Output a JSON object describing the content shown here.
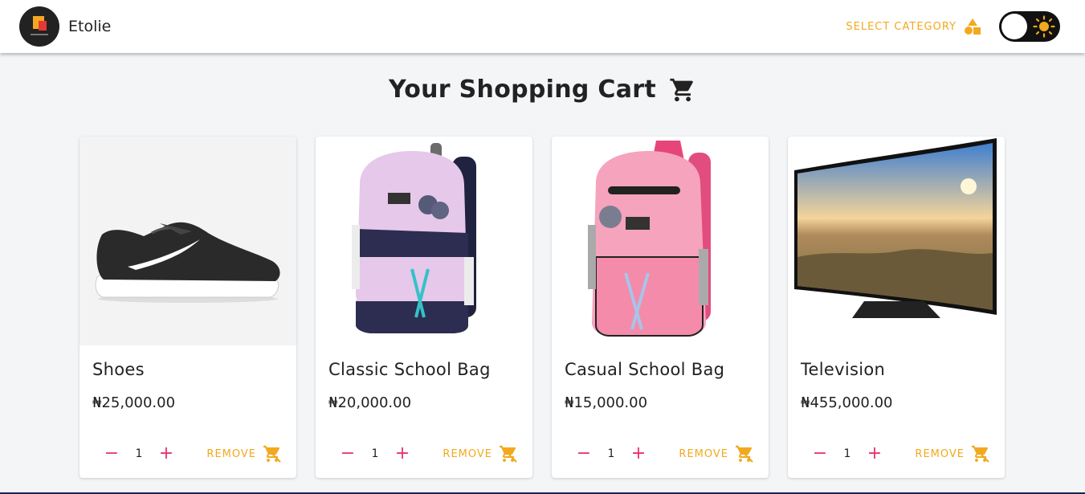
{
  "header": {
    "brand_name": "Etolie",
    "category_label": "SELECT CATEGORY"
  },
  "page": {
    "title": "Your Shopping Cart"
  },
  "cart": {
    "items": [
      {
        "name": "Shoes",
        "price": "₦25,000.00",
        "quantity": "1",
        "remove_label": "REMOVE",
        "image": "sneaker-image"
      },
      {
        "name": "Classic School Bag",
        "price": "₦20,000.00",
        "quantity": "1",
        "remove_label": "REMOVE",
        "image": "lavender-backpack-image"
      },
      {
        "name": "Casual School Bag",
        "price": "₦15,000.00",
        "quantity": "1",
        "remove_label": "REMOVE",
        "image": "pink-backpack-image"
      },
      {
        "name": "Television",
        "price": "₦455,000.00",
        "quantity": "1",
        "remove_label": "REMOVE",
        "image": "curved-tv-image"
      }
    ]
  },
  "colors": {
    "accent": "#f2a91e",
    "quantity_controls": "#e8336d",
    "background": "#f4f5f7"
  }
}
